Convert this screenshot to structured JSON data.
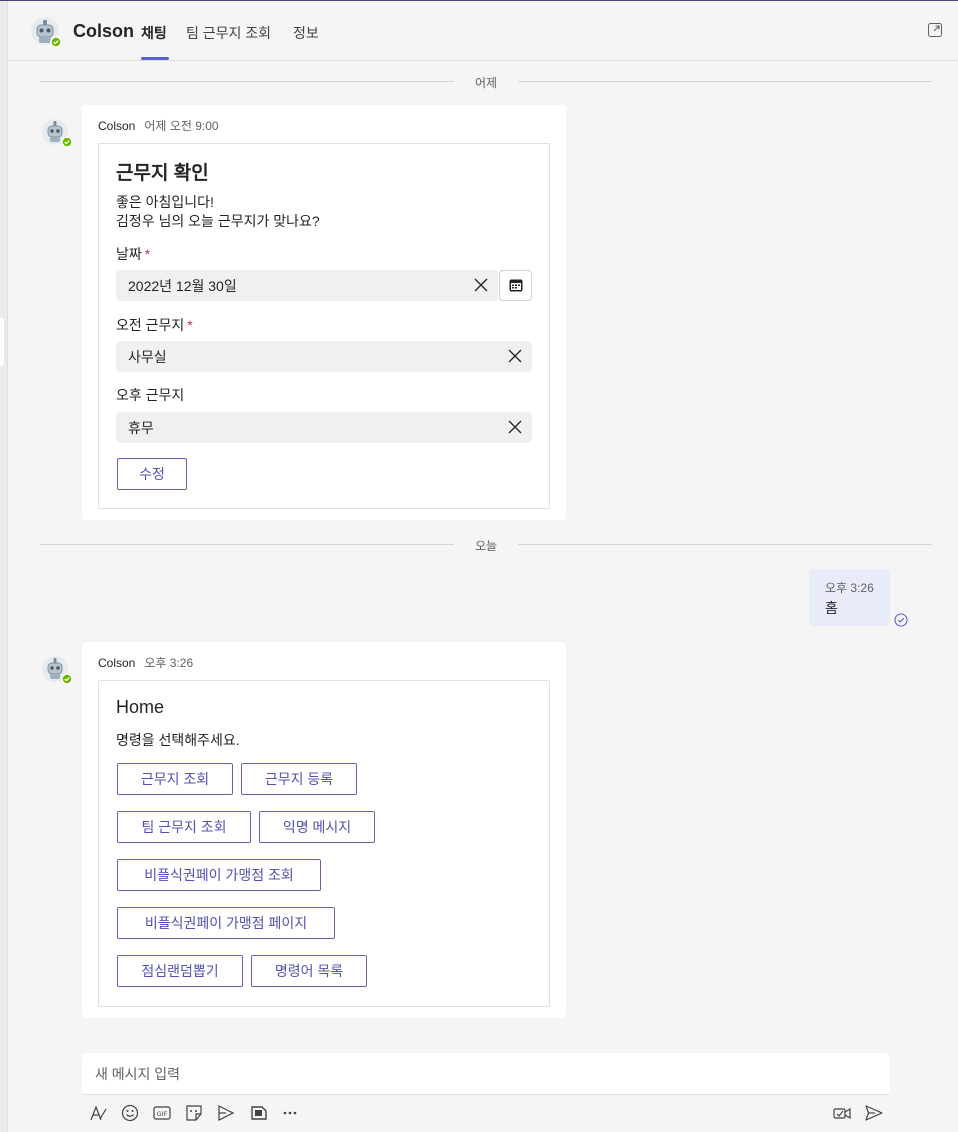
{
  "header": {
    "title": "Colson",
    "tabs": [
      {
        "label": "채팅",
        "active": true
      },
      {
        "label": "팀 근무지 조회",
        "active": false
      },
      {
        "label": "정보",
        "active": false
      }
    ]
  },
  "dividers": {
    "yesterday": "어제",
    "today": "오늘"
  },
  "message1": {
    "sender": "Colson",
    "time": "어제 오전 9:00",
    "card": {
      "title": "근무지 확인",
      "greeting": "좋은 아침입니다!",
      "question": "김정우 님의 오늘 근무지가 맞나요?",
      "date_label": "날짜",
      "date_value": "2022년 12월 30일",
      "am_label": "오전 근무지",
      "am_value": "사무실",
      "pm_label": "오후 근무지",
      "pm_value": "휴무",
      "required_mark": "*",
      "submit_label": "수정"
    }
  },
  "sent_message": {
    "time": "오후 3:26",
    "text": "홈"
  },
  "message2": {
    "sender": "Colson",
    "time": "오후 3:26",
    "card": {
      "title": "Home",
      "prompt": "명령을 선택해주세요.",
      "buttons": [
        "근무지 조회",
        "근무지 등록",
        "팀 근무지 조회",
        "익명 메시지",
        "비플식권페이 가맹점 조회",
        "비플식권페이 가맹점 페이지",
        "점심랜덤뽑기",
        "명령어 목록"
      ]
    }
  },
  "composer": {
    "placeholder": "새 메시지 입력",
    "tools": [
      "format-icon",
      "emoji-icon",
      "gif-icon",
      "sticker-icon",
      "stream-icon",
      "loop-icon",
      "more-icon"
    ],
    "right_tools": [
      "meet-now-icon",
      "send-icon"
    ]
  },
  "colors": {
    "accent": "#5b5fc7",
    "button_border": "#6264a7",
    "sent_bubble": "#e8ebfa",
    "required": "#c4314b"
  }
}
